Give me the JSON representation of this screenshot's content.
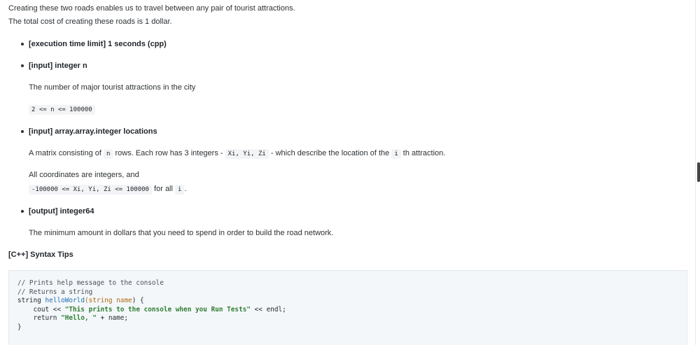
{
  "intro": {
    "line1": "Creating these two roads enables us to travel between any pair of tourist attractions.",
    "line2": "The total cost of creating these roads is 1 dollar."
  },
  "spec": {
    "exec_limit": "[execution time limit] 1 seconds (cpp)",
    "input_n": {
      "title": "[input] integer n",
      "desc": "The number of major tourist attractions in the city",
      "constraint": "2 <= n <= 100000"
    },
    "input_locations": {
      "title": "[input] array.array.integer locations",
      "desc_pre": "A matrix consisting of",
      "code_n": "n",
      "desc_mid": "rows. Each row has 3 integers -",
      "code_xyz": "Xi, Yi, Zi",
      "desc_post": "- which describe the location of the",
      "code_i": "i",
      "desc_end": "th attraction.",
      "coords_line": "All coordinates are integers, and",
      "range_code": "-100000 <= Xi, Yi, Zi <= 100000",
      "range_post": "for all",
      "range_i": "i",
      "range_dot": "."
    },
    "output": {
      "title": "[output] integer64",
      "desc": "The minimum amount in dollars that you need to spend in order to build the road network."
    }
  },
  "syntax": {
    "title": "[C++] Syntax Tips",
    "code": {
      "c1": "// Prints help message to the console",
      "c2": "// Returns a string",
      "l3_type": "string",
      "l3_fn": "helloWorld",
      "l3_open": "(",
      "l3_param": "string name",
      "l3_close": ") {",
      "l4_pre": "    cout << ",
      "l4_str": "\"This prints to the console when you Run Tests\"",
      "l4_post": " << endl;",
      "l5_pre": "    return ",
      "l5_str": "\"Hello, \"",
      "l5_post": " + name;",
      "l6": "}"
    }
  }
}
